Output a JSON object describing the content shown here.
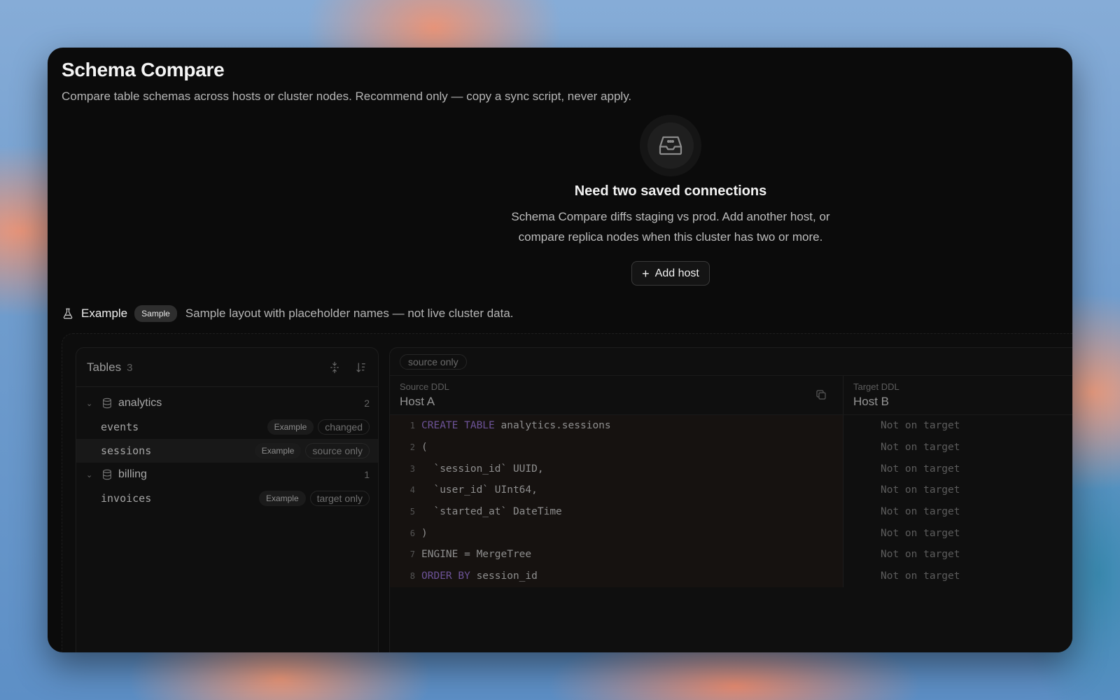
{
  "page": {
    "title": "Schema Compare",
    "subtitle": "Compare table schemas across hosts or cluster nodes. Recommend only — copy a sync script, never apply."
  },
  "empty_state": {
    "icon": "inbox-icon",
    "title": "Need two saved connections",
    "description": "Schema Compare diffs staging vs prod. Add another host, or compare replica nodes when this cluster has two or more.",
    "button_label": "Add host"
  },
  "example": {
    "icon": "flask-icon",
    "label": "Example",
    "badge": "Sample",
    "description": "Sample layout with placeholder names — not live cluster data."
  },
  "tables_panel": {
    "title": "Tables",
    "count": "3",
    "groups": [
      {
        "name": "analytics",
        "count": "2",
        "tables": [
          {
            "name": "events",
            "tag": "Example",
            "status": "changed"
          },
          {
            "name": "sessions",
            "tag": "Example",
            "status": "source only",
            "selected": true
          }
        ]
      },
      {
        "name": "billing",
        "count": "1",
        "tables": [
          {
            "name": "invoices",
            "tag": "Example",
            "status": "target only"
          }
        ]
      }
    ]
  },
  "diff": {
    "status": "source only",
    "source": {
      "caption": "Source DDL",
      "host": "Host A"
    },
    "target": {
      "caption": "Target DDL",
      "host": "Host B"
    },
    "lines": [
      {
        "n": "1",
        "kw": "CREATE TABLE",
        "rest": " analytics.sessions"
      },
      {
        "n": "2",
        "kw": "",
        "rest": "("
      },
      {
        "n": "3",
        "kw": "",
        "rest": "  `session_id` UUID,"
      },
      {
        "n": "4",
        "kw": "",
        "rest": "  `user_id` UInt64,"
      },
      {
        "n": "5",
        "kw": "",
        "rest": "  `started_at` DateTime"
      },
      {
        "n": "6",
        "kw": "",
        "rest": ")"
      },
      {
        "n": "7",
        "kw": "",
        "rest": "ENGINE = MergeTree"
      },
      {
        "n": "8",
        "kw": "ORDER BY",
        "rest": " session_id"
      }
    ],
    "target_placeholder": "Not on target"
  },
  "colors": {
    "window_bg": "#0b0b0b",
    "keyword": "#6d5398",
    "source_code_bg": "#161210"
  }
}
